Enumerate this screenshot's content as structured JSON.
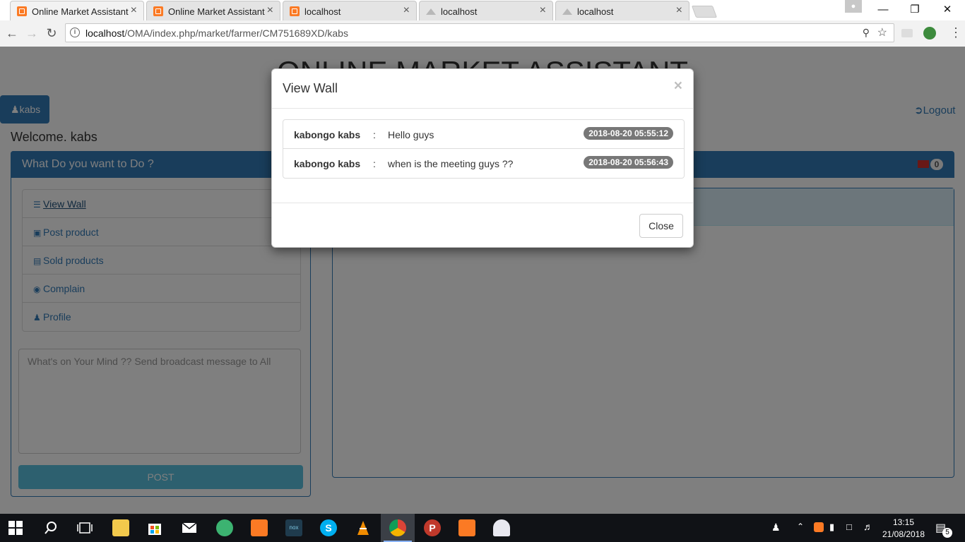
{
  "browser": {
    "tabs": [
      {
        "title": "Online Market Assistant",
        "icon": "xampp-icon",
        "active": true
      },
      {
        "title": "Online Market Assistant",
        "icon": "xampp-icon",
        "active": false
      },
      {
        "title": "localhost",
        "icon": "xampp-icon",
        "active": false
      },
      {
        "title": "localhost",
        "icon": "phpmyadmin-icon",
        "active": false
      },
      {
        "title": "localhost",
        "icon": "phpmyadmin-icon",
        "active": false
      }
    ],
    "tab_close": "×",
    "url_host": "localhost",
    "url_path": "/OMA/index.php/market/farmer/CM751689XD/kabs",
    "window_controls": {
      "minimize": "—",
      "maximize": "❐",
      "close": "✕"
    }
  },
  "page": {
    "site_title": "ONLINE MARKET ASSISTANT",
    "user_button": "kabs",
    "logout": "Logout",
    "welcome": "Welcome. kabs",
    "panel_heading": "What Do you want to Do ?",
    "mail_count": "0",
    "menu": [
      {
        "label": "View Wall",
        "icon": "list-icon"
      },
      {
        "label": "Post product",
        "icon": "picture-icon"
      },
      {
        "label": "Sold products",
        "icon": "money-icon"
      },
      {
        "label": "Complain",
        "icon": "chat-icon"
      },
      {
        "label": "Profile",
        "icon": "user-icon"
      }
    ],
    "broadcast_placeholder": "What's on Your Mind ??  Send broadcast message to All",
    "post_button": "POST"
  },
  "modal": {
    "title": "View Wall",
    "close_x": "×",
    "messages": [
      {
        "author": "kabongo kabs",
        "text": "Hello guys",
        "time": "2018-08-20 05:55:12"
      },
      {
        "author": "kabongo kabs",
        "text": "when is the meeting guys ??",
        "time": "2018-08-20 05:56:43"
      }
    ],
    "close_button": "Close"
  },
  "taskbar": {
    "time": "13:15",
    "date": "21/08/2018",
    "notification_count": "5"
  },
  "colors": {
    "primary": "#337ab7",
    "info": "#5bc0de",
    "badge": "#777777",
    "xampp": "#fb7a24"
  }
}
